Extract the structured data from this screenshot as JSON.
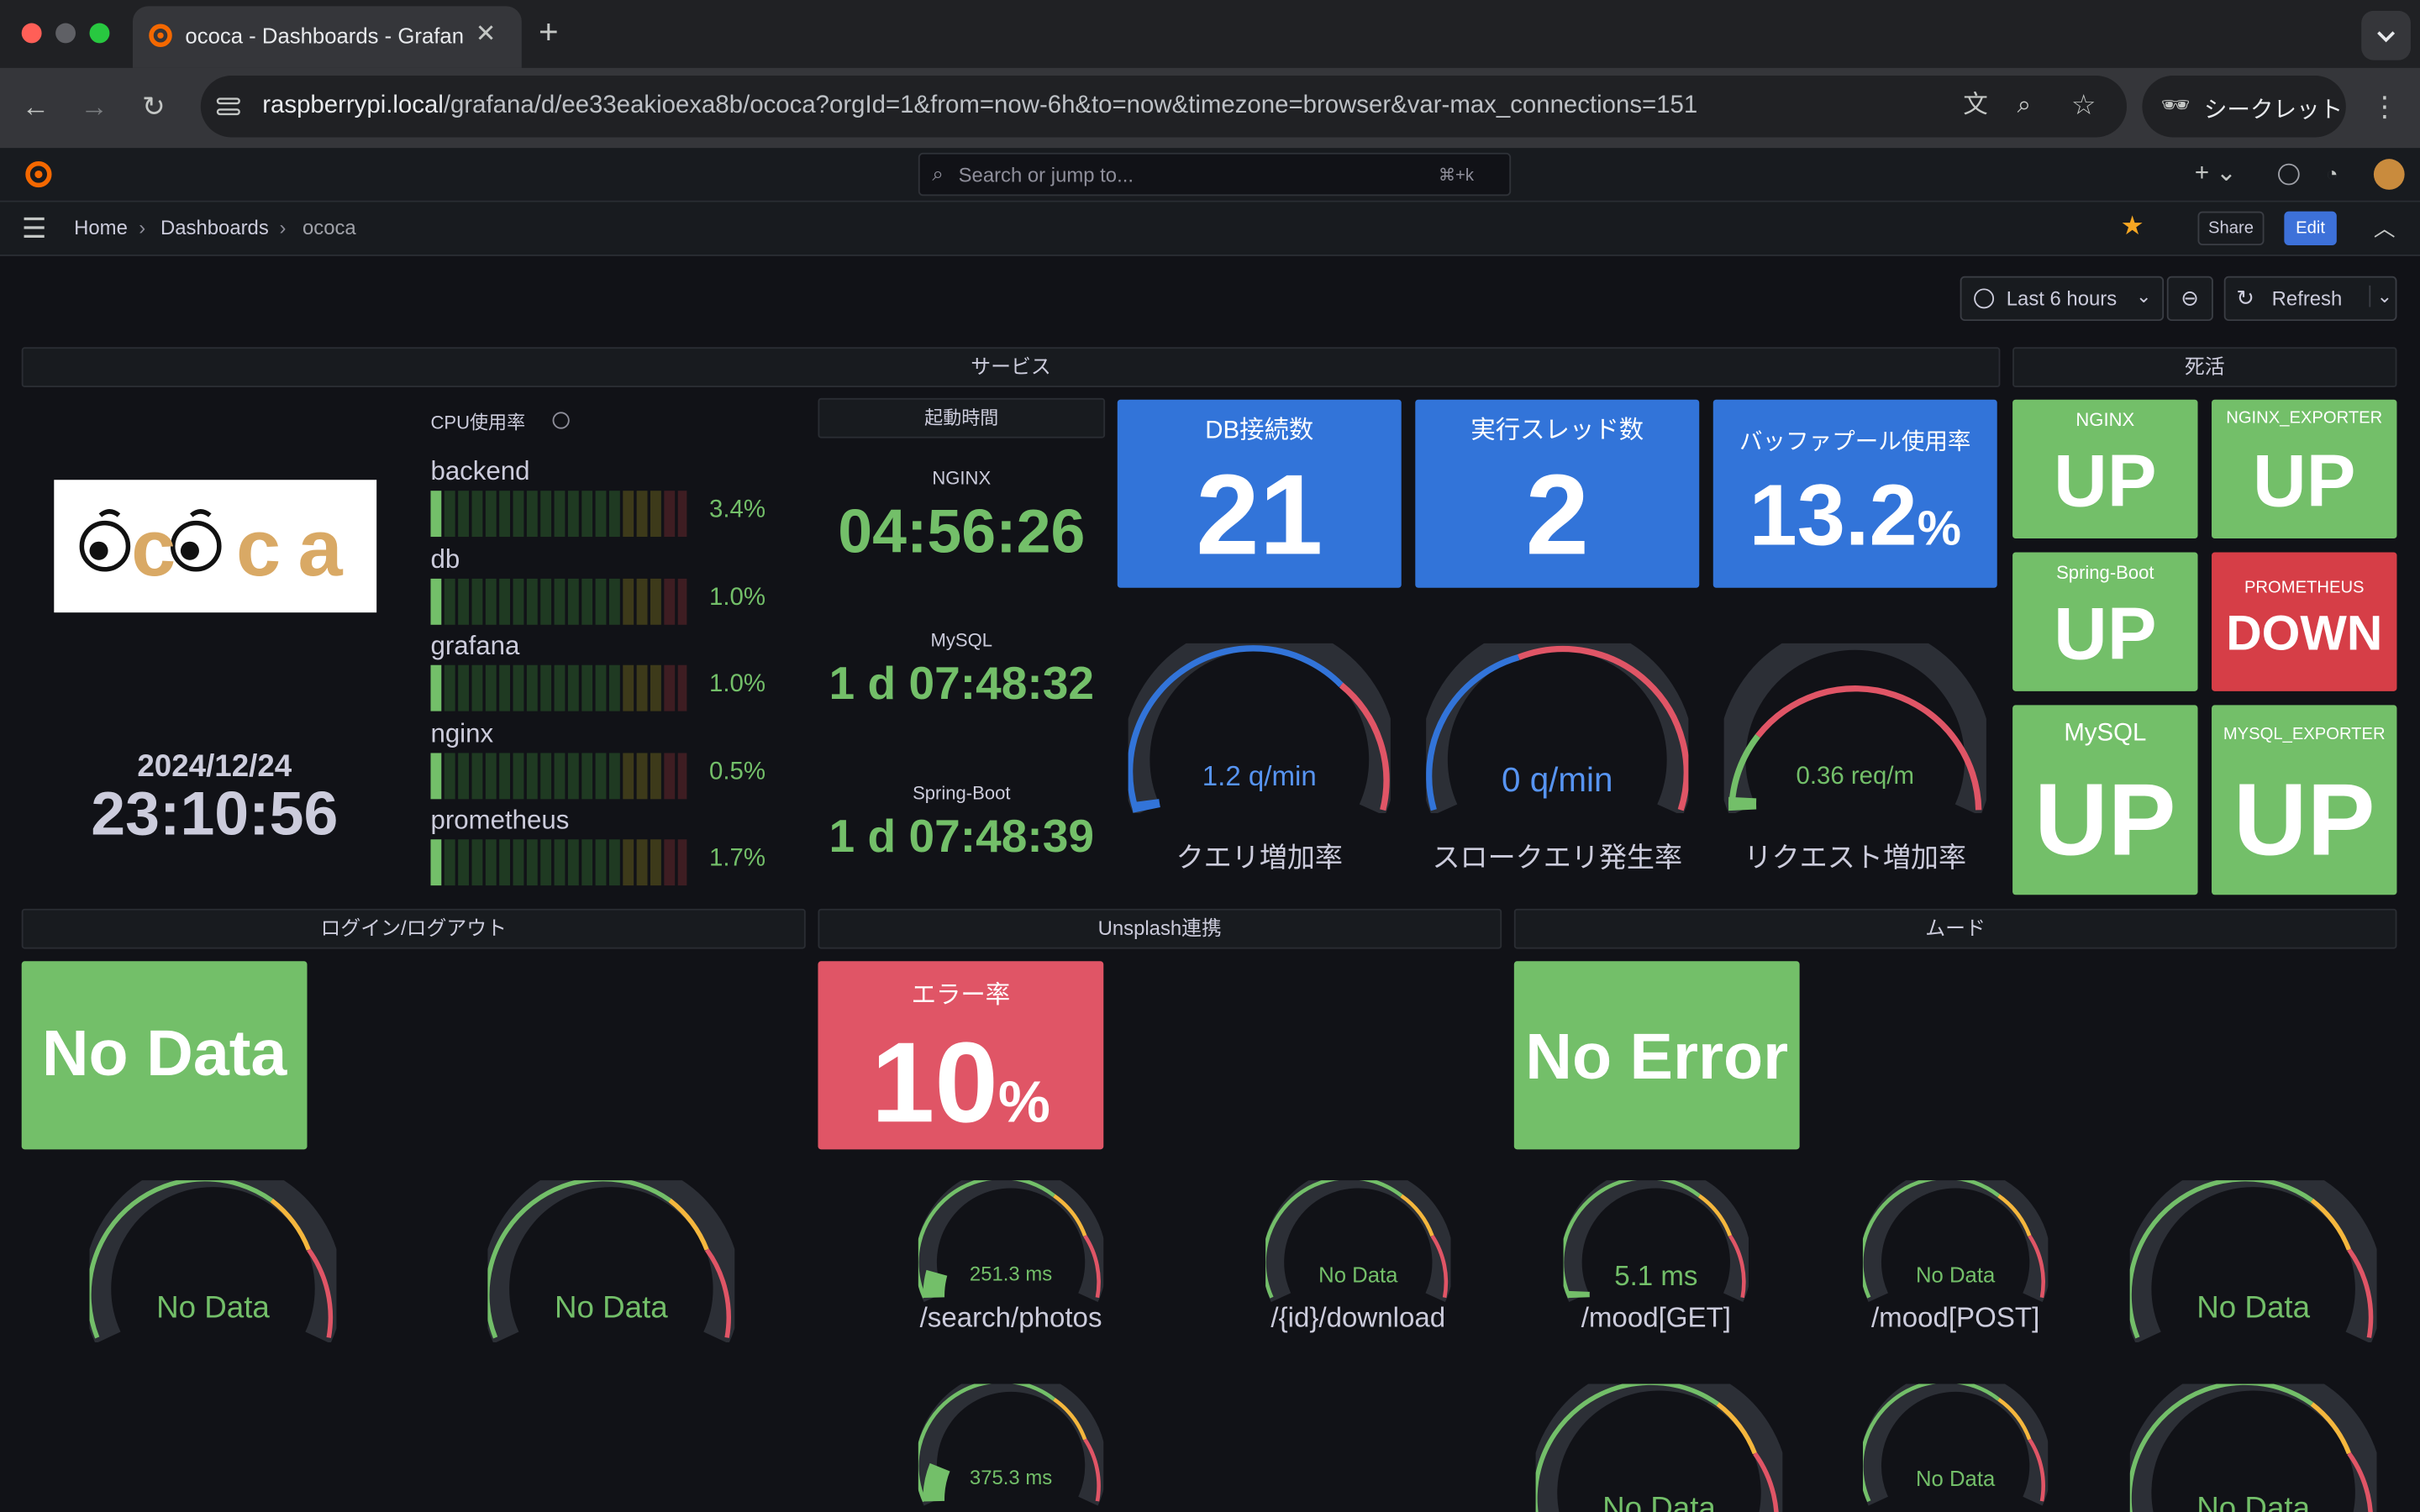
{
  "browser": {
    "tab_title": "ococa - Dashboards - Grafana",
    "url_host": "raspberrypi.local",
    "url_path": "/grafana/d/ee33eakioexa8b/ococa?orgId=1&from=now-6h&to=now&timezone=browser&var-max_connections=151",
    "incognito_label": "シークレット"
  },
  "grafana": {
    "search_placeholder": "Search or jump to...",
    "search_shortcut": "⌘+k",
    "breadcrumbs": [
      "Home",
      "Dashboards",
      "ococa"
    ],
    "share_label": "Share",
    "edit_label": "Edit",
    "time_range_label": "Last 6 hours",
    "refresh_label": "Refresh"
  },
  "rows": {
    "service": "サービス",
    "liveness": "死活",
    "login": "ログイン/ログアウト",
    "unsplash": "Unsplash連携",
    "mood": "ムード"
  },
  "logo": {
    "text": "ococa"
  },
  "clock": {
    "date": "2024/12/24",
    "time": "23:10:56"
  },
  "cpu": {
    "title": "CPU使用率",
    "items": [
      {
        "name": "backend",
        "value": "3.4%",
        "pct": 3.4
      },
      {
        "name": "db",
        "value": "1.0%",
        "pct": 1.0
      },
      {
        "name": "grafana",
        "value": "1.0%",
        "pct": 1.0
      },
      {
        "name": "nginx",
        "value": "0.5%",
        "pct": 0.5
      },
      {
        "name": "prometheus",
        "value": "1.7%",
        "pct": 1.7
      }
    ]
  },
  "uptime": {
    "title": "起動時間",
    "items": [
      {
        "name": "NGINX",
        "value": "04:56:26"
      },
      {
        "name": "MySQL",
        "value": "1 d 07:48:32"
      },
      {
        "name": "Spring-Boot",
        "value": "1 d 07:48:39"
      }
    ]
  },
  "stats": {
    "db_connections": {
      "title": "DB接続数",
      "value": "21"
    },
    "threads": {
      "title": "実行スレッド数",
      "value": "2"
    },
    "buffer_pool": {
      "title": "バッファプール使用率",
      "value": "13.2",
      "unit": "%"
    }
  },
  "gauges": {
    "query_rate": {
      "label": "クエリ増加率",
      "value": "1.2 q/min"
    },
    "slow_query_rate": {
      "label": "スロークエリ発生率",
      "value": "0 q/min"
    },
    "request_rate": {
      "label": "リクエスト増加率",
      "value": "0.36 req/m"
    }
  },
  "liveness": [
    {
      "name": "NGINX",
      "status": "UP",
      "color": "#73bf69"
    },
    {
      "name": "NGINX_EXPORTER",
      "status": "UP",
      "color": "#73bf69"
    },
    {
      "name": "Spring-Boot",
      "status": "UP",
      "color": "#73bf69"
    },
    {
      "name": "PROMETHEUS",
      "status": "DOWN",
      "color": "#e02f44"
    },
    {
      "name": "MySQL",
      "status": "UP",
      "color": "#73bf69"
    },
    {
      "name": "MYSQL_EXPORTER",
      "status": "UP",
      "color": "#73bf69"
    }
  ],
  "login": {
    "stat_value": "No Data",
    "gauge1": "No Data",
    "gauge2": "No Data"
  },
  "unsplash": {
    "error_title": "エラー率",
    "error_value": "10",
    "error_unit": "%",
    "search_gauge_value": "251.3 ms",
    "search_gauge_label": "/search/photos",
    "download_gauge_value": "No Data",
    "download_gauge_label": "/{id}/download",
    "bottom_gauge_value": "375.3 ms"
  },
  "mood": {
    "stat_value": "No Error",
    "get_gauge_value": "5.1 ms",
    "get_gauge_label": "/mood[GET]",
    "post_gauge_value": "No Data",
    "post_gauge_label": "/mood[POST]",
    "right_gauge_value": "No Data",
    "bottom1": "No Data",
    "bottom2": "No Data",
    "bottom3": "No Data"
  },
  "colors": {
    "green": "#73bf69",
    "blue": "#3274d9",
    "red": "#e05566",
    "orange": "#f5b73d",
    "background": "#111217"
  }
}
